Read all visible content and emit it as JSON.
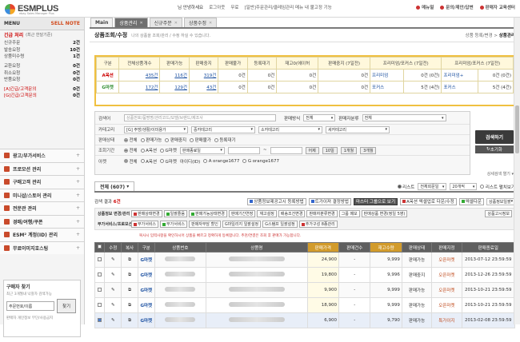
{
  "app": {
    "logo": "ESMPLUS",
    "logo_sub": "ebay Sales Manager Plus"
  },
  "top": {
    "user": "님 안녕하세요",
    "logout": "로그아웃",
    "free": "무료",
    "notice": "[일반]주문관리/클레임관리 메뉴 내 불고정 기능",
    "menu_help": "메뉴얼",
    "inquiry": "문의/제안/답변",
    "seller_edu": "판매자 교육센터"
  },
  "side": {
    "menu": "MENU",
    "sell_note": "SELL NOTE",
    "urgent": "긴급 처리",
    "urgent_note": "(최근 한달기준)",
    "items": [
      {
        "l": "신규주문",
        "v": "2건"
      },
      {
        "l": "발송요청",
        "v": "10건"
      },
      {
        "l": "상품미수령",
        "v": "1건"
      },
      {
        "l": "교환요청",
        "v": "0건"
      },
      {
        "l": "취소요청",
        "v": "0건"
      },
      {
        "l": "반품요청",
        "v": "0건"
      },
      {
        "l": "[A]긴급/고객문의",
        "v": "0건"
      },
      {
        "l": "[G]긴급/고객문의",
        "v": "0건"
      }
    ],
    "menus": [
      "광고/부가서비스",
      "프로모션 관리",
      "구매고객 관리",
      "미니샵/스토어 관리",
      "전문관 관리",
      "경매/여행/쿠폰",
      "ESM² 계정(ID) 관리",
      "무료이미지호스팅"
    ],
    "bk": {
      "title": "구매자 찾기",
      "desc": "최근 3개월내 낙찰자 검색가능",
      "sel": "주문번호/이름",
      "btn": "찾기",
      "foot": "판매자 개인정보 무단/사용금지"
    }
  },
  "tabs": {
    "main": "Main",
    "t1": "상품관리",
    "t2": "신규주문",
    "t3": "상품수정"
  },
  "page": {
    "title": "상품조회/수정",
    "desc": "나의 상품을 조회/관리 / 수정 하실 수 있습니다.",
    "bread1": "상품 등록/변경",
    "bread2": "상품관리"
  },
  "summary": {
    "headers": [
      "구분",
      "전체상품개수",
      "판매가능",
      "판매중지",
      "판매불가",
      "등록대기",
      "재고0(에이허",
      "판매중지 (7일전)",
      "프리미엄/포커스 (7일전)",
      "",
      "프리미엄/포커스 (7일전)",
      ""
    ],
    "rows": [
      {
        "site": "A옥션",
        "total": "435건",
        "sellable": "116건",
        "stop": "319건",
        "unable": "0건",
        "wait": "0건",
        "zero": "0건",
        "stop7": "0건",
        "p1": "프리미엄",
        "p1v": "0건 (0건)",
        "p2": "프리미엄+",
        "p2v": "0건 (0건)"
      },
      {
        "site": "G마켓",
        "total": "172건",
        "sellable": "129건",
        "stop": "43건",
        "unable": "0건",
        "wait": "0건",
        "zero": "0건",
        "stop7": "0건",
        "p1": "포커스",
        "p1v": "5건 (4건)",
        "p2": "포커스",
        "p2v": "5건 (4건)"
      }
    ]
  },
  "filter": {
    "search_label": "검색어",
    "search_ph": "상품번호/품명명/관리코드/모델/브랜드/제조사",
    "sell_method_label": "판매방식",
    "sell_method": "전체",
    "sell_cat_label": "판매자분류",
    "sell_cat": "전체",
    "cat_label": "카테고리",
    "cat1": "[G] 주방/생활/이미용가",
    "cat2": "중카테고리",
    "cat3": "소카테고리",
    "cat4": "세카테고리",
    "status_label": "판매상태",
    "status_opts": [
      "전체",
      "판매가능",
      "판매중지",
      "판매불가",
      "등록대기"
    ],
    "period_label": "조회기간",
    "period_opts": [
      "전체",
      "A옥션",
      "G마켓"
    ],
    "date_sel": "판매종료일",
    "tilde": "~",
    "p1": "어제",
    "p2": "10일",
    "p3": "1개월",
    "p4": "3개월",
    "site_label": "아켓",
    "site_opts": [
      "전체",
      "A옥션",
      "G마켓"
    ],
    "id_label": "아이디(ID)",
    "id_a": "orange1677",
    "id_g": "orange1677",
    "search_btn": "검색하기",
    "reset_btn": "초기화",
    "detail": "상세검색 열기"
  },
  "results": {
    "tab": "전체 (607)",
    "list": "리스트",
    "sort": "전체회문일",
    "per": "20개씩",
    "fix": "리스트 펼치보기",
    "count_label": "검색 결과",
    "count": "6건",
    "btn_a": "상품정보제공고시 등록방법",
    "btn_b": "트가이져 결정방법",
    "btn_c": "마스터 그룹으로 보기",
    "btn_d": "A옥션 엑셀업로 다운/수정",
    "btn_e": "엑셀다운",
    "sel_e": "상품정보일괄"
  },
  "bulk": {
    "row1_label": "상품정보 변경/관리",
    "row1": [
      "판매상태변경",
      "일괄즐음",
      "판매가능상태변경",
      "판매기간연장",
      "재고설정",
      "배송조건변경",
      "판매자분류변경",
      "그룹 메모",
      "판매상품 변경(정일 5영)"
    ],
    "row1_right": "상품고시정보",
    "row2_label": "부가서비스/프로모션",
    "row2": [
      "부가서비스",
      "부가서비스",
      "판매자부담 할인",
      "G마일리지 일괄설정",
      "G스탬프 일괄설정",
      "추가구성 8종관리"
    ],
    "help": "복사시 입력사항을 확인하시어 상품을 빠르고 정확하게 등록합니다. 추천/연결은 조회 후 판매가 가능합니다."
  },
  "grid": {
    "headers": [
      "",
      "수정",
      "복사",
      "구분",
      "상품번호",
      "상품명",
      "판매가격",
      "판매건수",
      "재고수량",
      "판매상태",
      "판매지정",
      "판매종료일"
    ],
    "rows": [
      {
        "site": "G마켓",
        "price": "24,900",
        "sold": "-",
        "stock": "9,999",
        "status": "판매가능",
        "spec": "오픈마켓",
        "end": "2013-07-12 23:59:59",
        "hl": false
      },
      {
        "site": "G마켓",
        "price": "19,800",
        "sold": "-",
        "stock": "9,996",
        "status": "판매중지",
        "spec": "오픈마켓",
        "end": "2013-12-26 23:59:59",
        "hl": false
      },
      {
        "site": "G마켓",
        "price": "9,900",
        "sold": "-",
        "stock": "9,999",
        "status": "판매가능",
        "spec": "오픈마켓",
        "end": "2013-10-21 23:59:59",
        "hl": false
      },
      {
        "site": "G마켓",
        "price": "18,900",
        "sold": "-",
        "stock": "9,999",
        "status": "판매가능",
        "spec": "오픈마켓",
        "end": "2013-10-21 23:59:59",
        "hl": false
      },
      {
        "site": "G마켓",
        "price": "6,900",
        "sold": "-",
        "stock": "9,790",
        "status": "판매가능",
        "spec": "특가이지",
        "end": "2013-02-08 23:59:59",
        "hl": true
      }
    ]
  },
  "colors": {
    "accent": "#d24a1c",
    "tab_active": "#6f6f6f",
    "summary_border": "#f0c040",
    "sort_header": "#d29b2b"
  }
}
